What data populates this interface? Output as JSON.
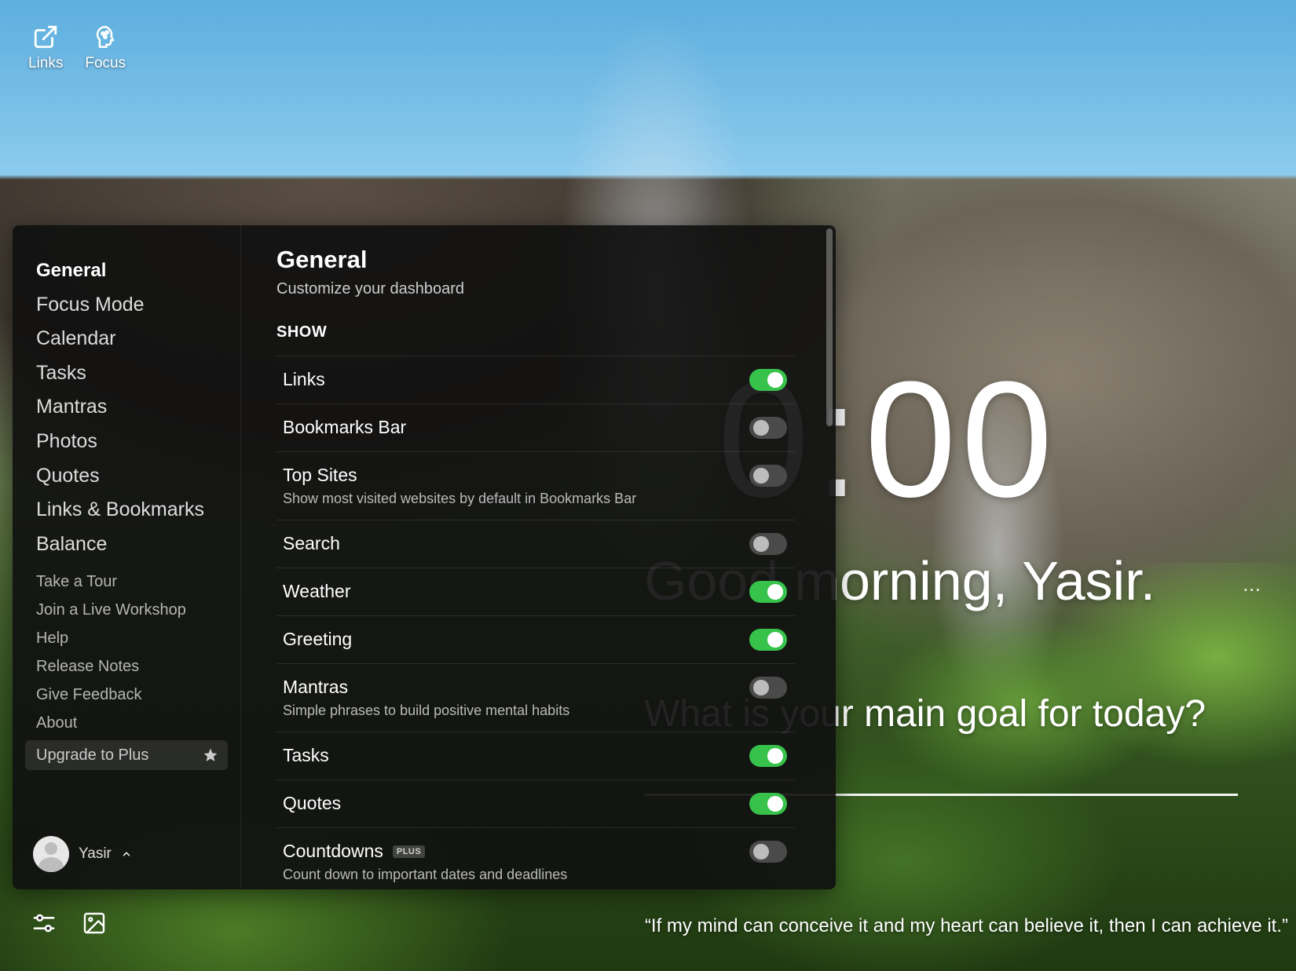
{
  "top_links": [
    {
      "label": "Links",
      "icon": "external-link-icon"
    },
    {
      "label": "Focus",
      "icon": "brain-icon"
    }
  ],
  "dashboard": {
    "clock": "0:00",
    "greeting": "Good morning, Yasir.",
    "greeting_more": "...",
    "goal_question": "What is your main goal for today?",
    "quote": "“If my mind can conceive it and my heart can believe it, then I can achieve it.”"
  },
  "bottom_icons": [
    "settings-sliders-icon",
    "photo-icon"
  ],
  "sidebar": {
    "primary": [
      "General",
      "Focus Mode",
      "Calendar",
      "Tasks",
      "Mantras",
      "Photos",
      "Quotes",
      "Links & Bookmarks",
      "Balance"
    ],
    "active": "General",
    "secondary": [
      "Take a Tour",
      "Join a Live Workshop",
      "Help",
      "Release Notes",
      "Give Feedback",
      "About"
    ],
    "upgrade_label": "Upgrade to Plus",
    "upgrade_icon": "star-icon",
    "user_name": "Yasir",
    "user_icon": "chevron-up-icon"
  },
  "content": {
    "title": "General",
    "subtitle": "Customize your dashboard",
    "section_label": "SHOW",
    "settings": [
      {
        "name": "Links",
        "desc": "",
        "on": true,
        "badge": ""
      },
      {
        "name": "Bookmarks Bar",
        "desc": "",
        "on": false,
        "badge": ""
      },
      {
        "name": "Top Sites",
        "desc": "Show most visited websites by default in Bookmarks Bar",
        "on": false,
        "badge": ""
      },
      {
        "name": "Search",
        "desc": "",
        "on": false,
        "badge": ""
      },
      {
        "name": "Weather",
        "desc": "",
        "on": true,
        "badge": ""
      },
      {
        "name": "Greeting",
        "desc": "",
        "on": true,
        "badge": ""
      },
      {
        "name": "Mantras",
        "desc": "Simple phrases to build positive mental habits",
        "on": false,
        "badge": ""
      },
      {
        "name": "Tasks",
        "desc": "",
        "on": true,
        "badge": ""
      },
      {
        "name": "Quotes",
        "desc": "",
        "on": true,
        "badge": ""
      },
      {
        "name": "Countdowns",
        "desc": "Count down to important dates and deadlines",
        "on": false,
        "badge": "PLUS"
      }
    ]
  },
  "colors": {
    "toggle_on": "#37c24b",
    "toggle_off": "#4a4a4a",
    "panel_bg": "#101010"
  }
}
